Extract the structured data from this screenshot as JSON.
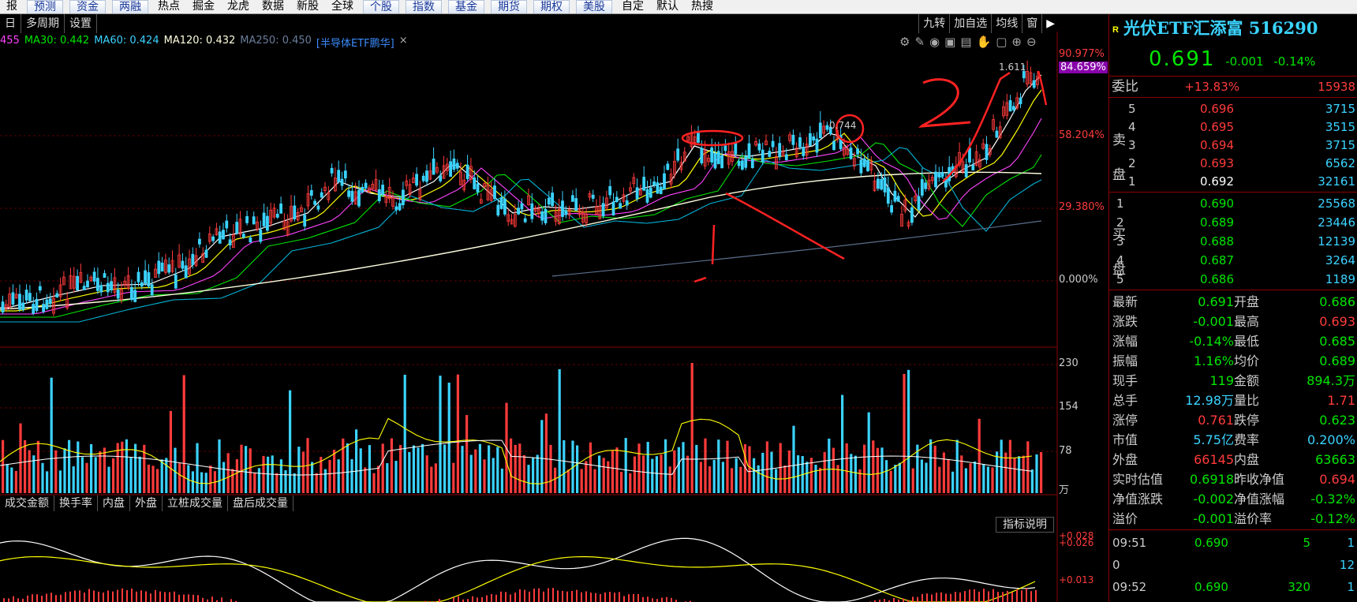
{
  "topbar": {
    "items": [
      "报",
      "预测",
      "资金",
      "两融",
      "热点",
      "掘金",
      "龙虎",
      "数据",
      "新股",
      "全球",
      "个股",
      "指数",
      "基金",
      "期货",
      "期权",
      "美股",
      "自定",
      "默认",
      "热搜"
    ]
  },
  "toolbar": {
    "tabs": [
      "日",
      "多周期",
      "设置"
    ],
    "right": [
      "九转",
      "加自选",
      "均线",
      "窗"
    ],
    "right_icon": "play-icon"
  },
  "ma": {
    "ma_partial": "455",
    "ma30": "MA30: 0.442",
    "ma60": "MA60: 0.424",
    "ma120": "MA120: 0.432",
    "ma250": "MA250: 0.450",
    "overlay": "[半导体ETF鹏华]",
    "close": "×"
  },
  "axis": {
    "pct1": "90.977%",
    "pct1b": "84.659%",
    "pct2": "58.204%",
    "pct3": "29.380%",
    "pct4": "0.000%",
    "vol1": "230",
    "vol2": "154",
    "vol3": "78",
    "vol_unit": "万",
    "ind1": "+0.028",
    "ind1b": "+0.026",
    "ind2": "+0.013"
  },
  "annotations": {
    "peak_label": "0.744",
    "top_label": "1.611",
    "handwrite_2": "2"
  },
  "subtabs": [
    "成交金额",
    "换手率",
    "内盘",
    "外盘",
    "立桩成交量",
    "盘后成交量"
  ],
  "help_button": "指标说明",
  "panel": {
    "badge": "R",
    "title": "光伏ETF汇添富 516290",
    "price": "0.691",
    "change": "-0.001",
    "change_pct": "-0.14%",
    "weibi_label": "委比",
    "weibi_pct": "+13.83%",
    "weibi_vol": "15938",
    "sell_label": "卖盘",
    "buy_label": "买盘",
    "sells": [
      {
        "i": "5",
        "p": "0.696",
        "v": "3715"
      },
      {
        "i": "4",
        "p": "0.695",
        "v": "3515"
      },
      {
        "i": "3",
        "p": "0.694",
        "v": "3715"
      },
      {
        "i": "2",
        "p": "0.693",
        "v": "6562"
      },
      {
        "i": "1",
        "p": "0.692",
        "v": "32161"
      }
    ],
    "buys": [
      {
        "i": "1",
        "p": "0.690",
        "v": "25568"
      },
      {
        "i": "2",
        "p": "0.689",
        "v": "23446"
      },
      {
        "i": "3",
        "p": "0.688",
        "v": "12139"
      },
      {
        "i": "4",
        "p": "0.687",
        "v": "3264"
      },
      {
        "i": "5",
        "p": "0.686",
        "v": "1189"
      }
    ],
    "quotes": [
      {
        "k1": "最新",
        "v1": "0.691",
        "c1": "green",
        "k2": "开盘",
        "v2": "0.686",
        "c2": "green"
      },
      {
        "k1": "涨跌",
        "v1": "-0.001",
        "c1": "green",
        "k2": "最高",
        "v2": "0.693",
        "c2": "red"
      },
      {
        "k1": "涨幅",
        "v1": "-0.14%",
        "c1": "green",
        "k2": "最低",
        "v2": "0.685",
        "c2": "green"
      },
      {
        "k1": "振幅",
        "v1": "1.16%",
        "c1": "green",
        "k2": "均价",
        "v2": "0.689",
        "c2": "green"
      },
      {
        "k1": "现手",
        "v1": "119",
        "c1": "green",
        "k2": "金额",
        "v2": "894.3万",
        "c2": "green"
      },
      {
        "k1": "总手",
        "v1": "12.98万",
        "c1": "cyan",
        "k2": "量比",
        "v2": "1.71",
        "c2": "red"
      },
      {
        "k1": "涨停",
        "v1": "0.761",
        "c1": "red",
        "k2": "跌停",
        "v2": "0.623",
        "c2": "green"
      },
      {
        "k1": "市值",
        "v1": "5.75亿",
        "c1": "cyan",
        "k2": "费率",
        "v2": "0.200%",
        "c2": "cyan"
      },
      {
        "k1": "外盘",
        "v1": "66145",
        "c1": "red",
        "k2": "内盘",
        "v2": "63663",
        "c2": "green"
      },
      {
        "k1": "实时估值",
        "v1": "0.6918",
        "c1": "green",
        "k2": "昨收净值",
        "v2": "0.694",
        "c2": "red"
      },
      {
        "k1": "净值涨跌",
        "v1": "-0.002",
        "c1": "green",
        "k2": "净值涨幅",
        "v2": "-0.32%",
        "c2": "green"
      },
      {
        "k1": "溢价",
        "v1": "-0.001",
        "c1": "green",
        "k2": "溢价率",
        "v2": "-0.12%",
        "c2": "green"
      }
    ],
    "ticks": [
      {
        "t": "09:51",
        "p": "0.690",
        "v": "5",
        "n": "1"
      },
      {
        "t": "0",
        "p": "",
        "v": "",
        "n": "12"
      },
      {
        "t": "09:52",
        "p": "0.690",
        "v": "320",
        "n": "1"
      }
    ]
  },
  "colors": {
    "up": "#ff3b3b",
    "down": "#3bd3ff",
    "ma_white": "#ffffff",
    "ma_yellow": "#ffff00",
    "ma_magenta": "#ff44ff",
    "ma_green": "#00e600",
    "ma_teal": "#00b4d8",
    "ma_long": "#ffffe0",
    "ma_250": "#5a6e8c",
    "annotation": "#ff2222"
  }
}
